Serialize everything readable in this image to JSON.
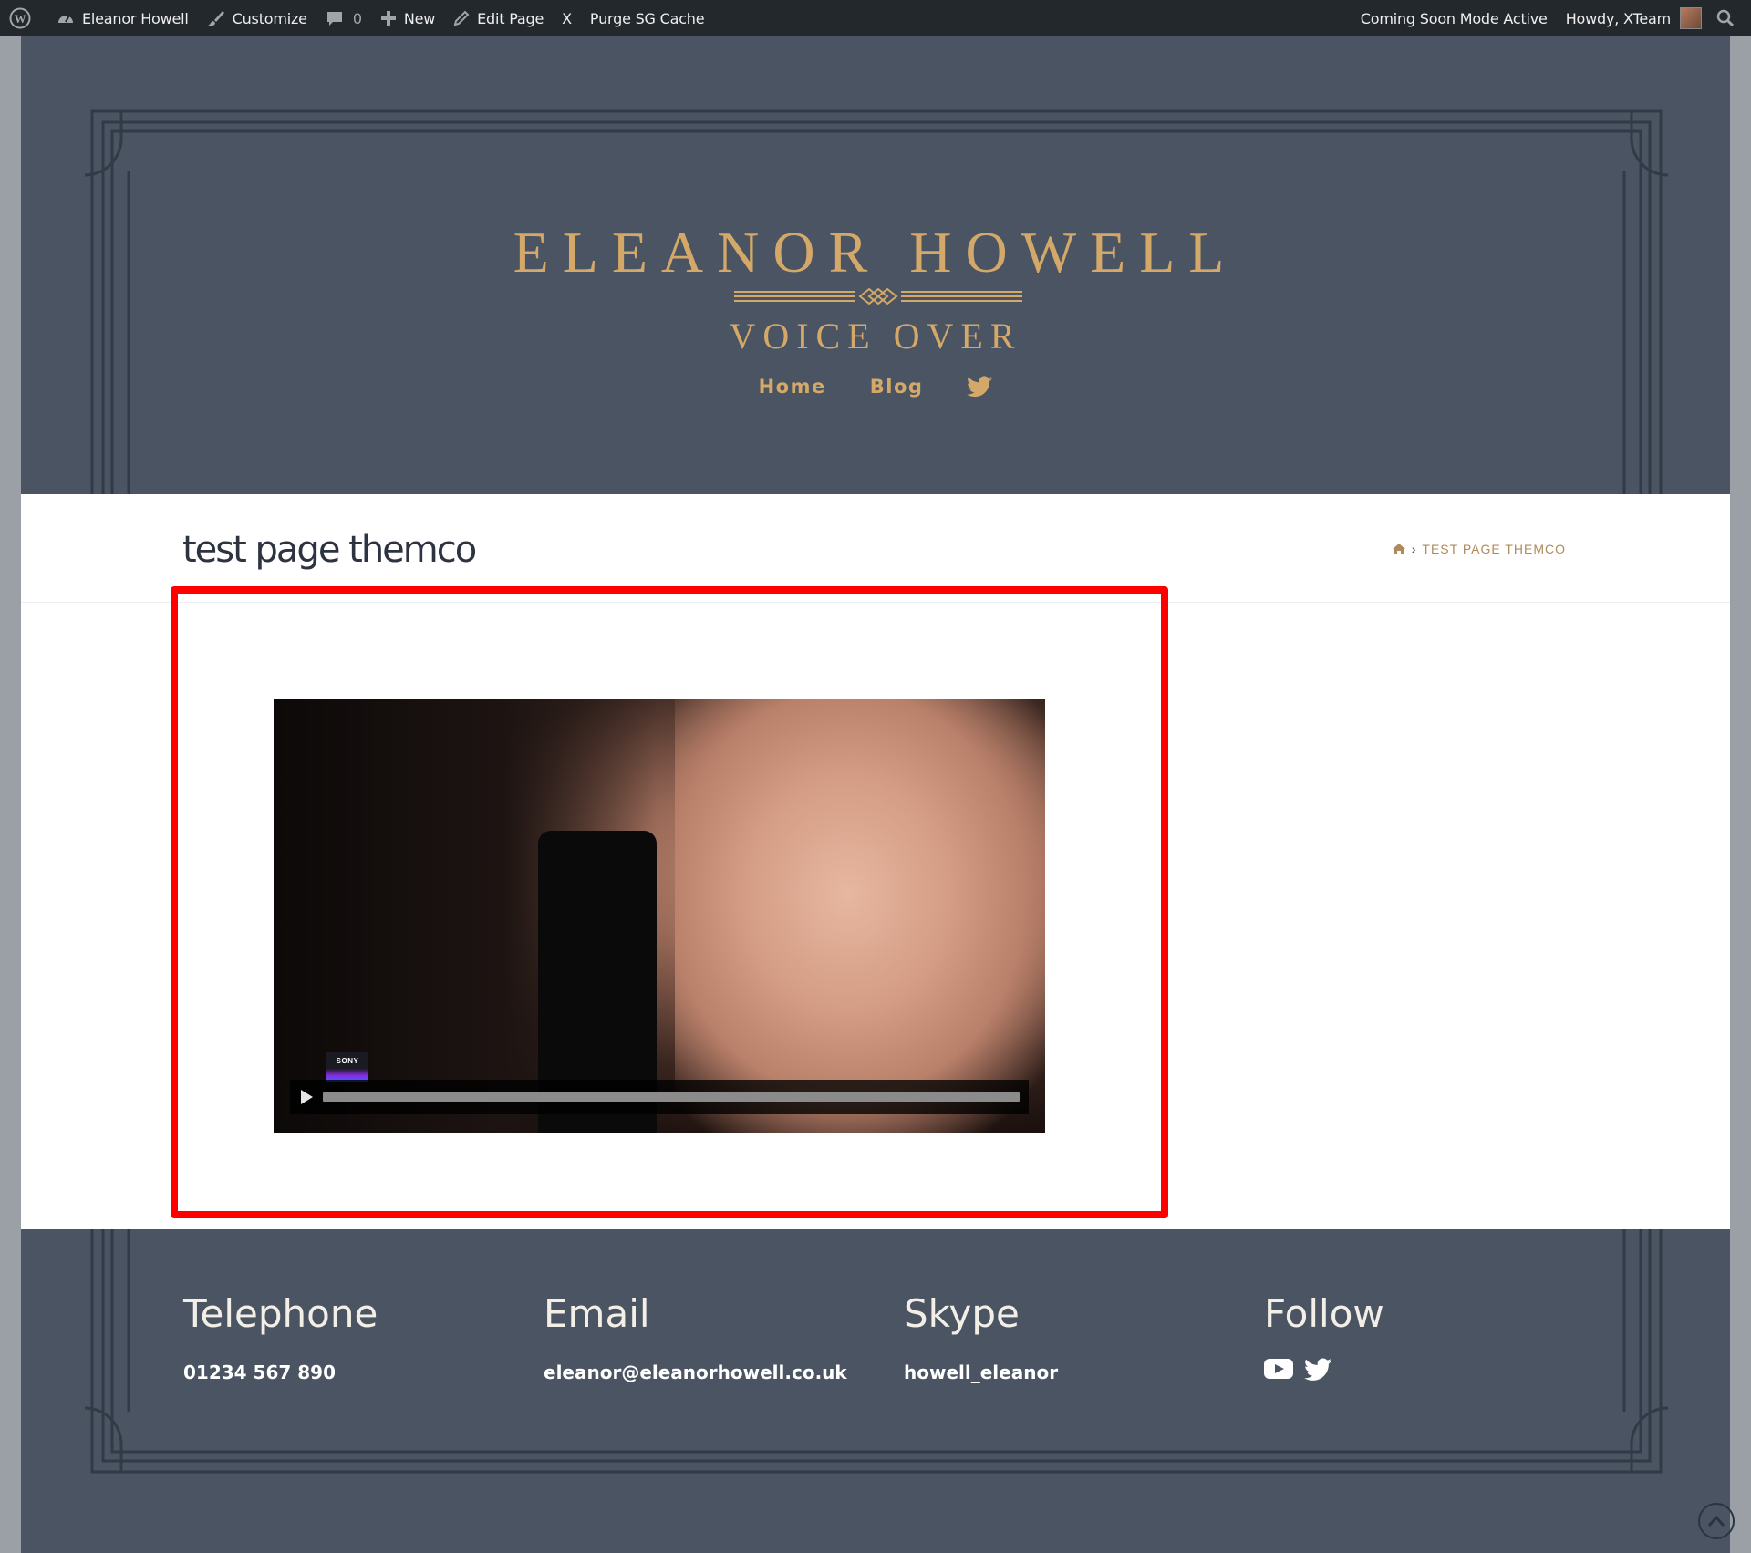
{
  "adminbar": {
    "site_name": "Eleanor Howell",
    "customize": "Customize",
    "comments_count": "0",
    "new": "New",
    "edit_page": "Edit Page",
    "x_label": "X",
    "purge": "Purge SG Cache",
    "coming_soon": "Coming Soon Mode Active",
    "howdy": "Howdy, XTeam"
  },
  "header": {
    "title": "ELEANOR HOWELL",
    "subtitle": "VOICE OVER",
    "nav": [
      {
        "label": "Home"
      },
      {
        "label": "Blog"
      }
    ]
  },
  "page": {
    "title": "test page themco",
    "breadcrumb_current": "TEST PAGE THEMCO"
  },
  "video": {
    "channel_logo": "SONY",
    "progress_fraction": 0.0
  },
  "footer": {
    "columns": [
      {
        "heading": "Telephone",
        "text": "01234 567 890"
      },
      {
        "heading": "Email",
        "text": "eleanor@eleanorhowell.co.uk"
      },
      {
        "heading": "Skype",
        "text": "howell_eleanor"
      },
      {
        "heading": "Follow"
      }
    ]
  },
  "colors": {
    "accent": "#d4a869",
    "header_bg": "#4a5462",
    "highlight": "#ff0000",
    "adminbar_bg": "#23282d"
  },
  "icons": [
    "wordpress-icon",
    "gauge-icon",
    "brush-icon",
    "comment-icon",
    "plus-icon",
    "pencil-icon",
    "search-icon",
    "twitter-icon",
    "home-icon",
    "youtube-icon",
    "play-icon",
    "chevron-up-icon"
  ]
}
